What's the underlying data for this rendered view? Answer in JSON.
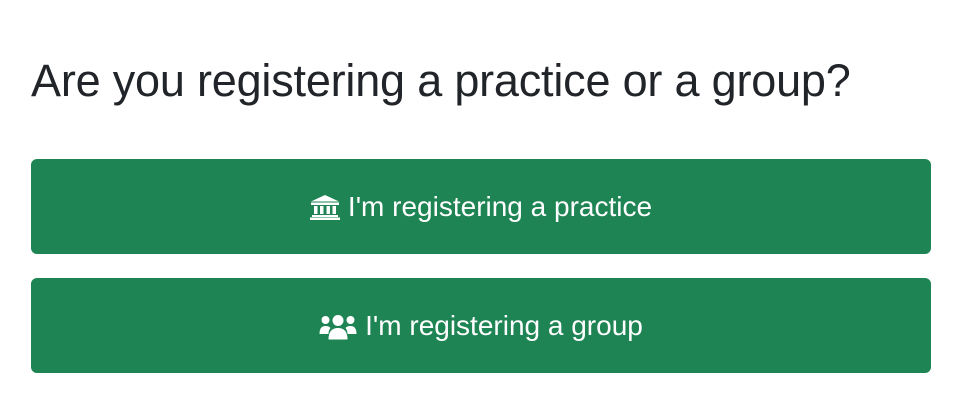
{
  "page": {
    "title": "Are you registering a practice or a group?"
  },
  "choices": [
    {
      "label": "I'm registering a practice",
      "icon": "landmark-icon"
    },
    {
      "label": "I'm registering a group",
      "icon": "users-icon"
    }
  ],
  "colors": {
    "button_bg": "#1e8453",
    "button_text": "#ffffff",
    "title_text": "#212529"
  }
}
